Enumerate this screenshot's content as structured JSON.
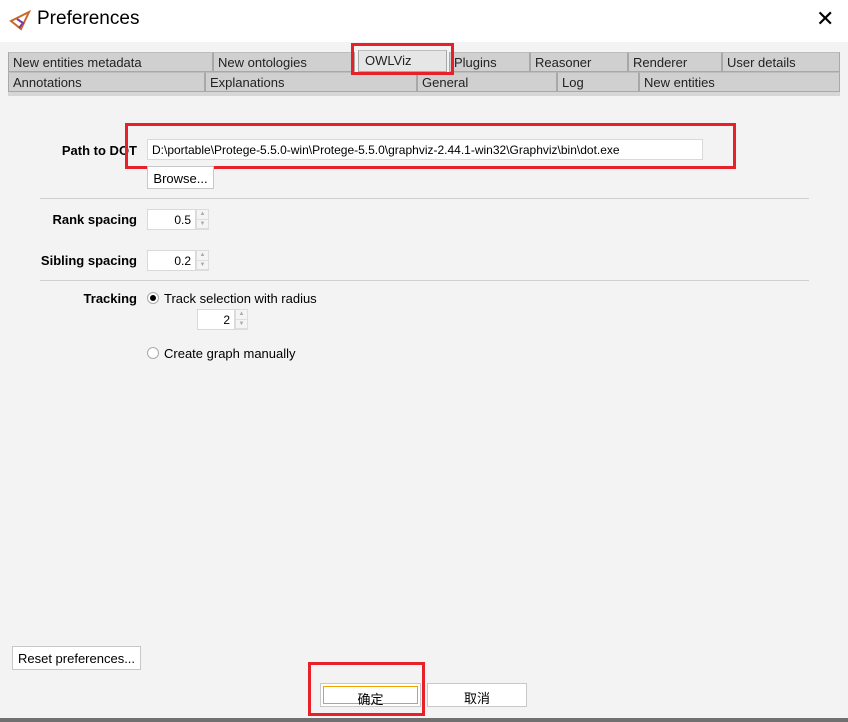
{
  "window": {
    "title": "Preferences",
    "icon": "protege-logo-icon",
    "close": "✕"
  },
  "tabs": {
    "row1": [
      "New entities metadata",
      "New ontologies",
      "OWLViz",
      "Plugins",
      "Reasoner",
      "Renderer",
      "User details"
    ],
    "row2": [
      "Annotations",
      "Explanations",
      "General",
      "Log",
      "New entities"
    ],
    "selected": "OWLViz"
  },
  "owlviz": {
    "path_label": "Path to DOT",
    "path_value": "D:\\portable\\Protege-5.5.0-win\\Protege-5.5.0\\graphviz-2.44.1-win32\\Graphviz\\bin\\dot.exe",
    "browse": "Browse...",
    "rank_label": "Rank spacing",
    "rank_value": "0.5",
    "sibling_label": "Sibling spacing",
    "sibling_value": "0.2",
    "tracking_label": "Tracking",
    "track_option": "Track selection with radius",
    "radius_value": "2",
    "manual_option": "Create graph manually",
    "tracking_selected": "Track selection with radius"
  },
  "footer": {
    "reset": "Reset preferences...",
    "ok": "确定",
    "cancel": "取消"
  },
  "colors": {
    "highlight": "#e8202a",
    "focus": "#f0a000"
  }
}
